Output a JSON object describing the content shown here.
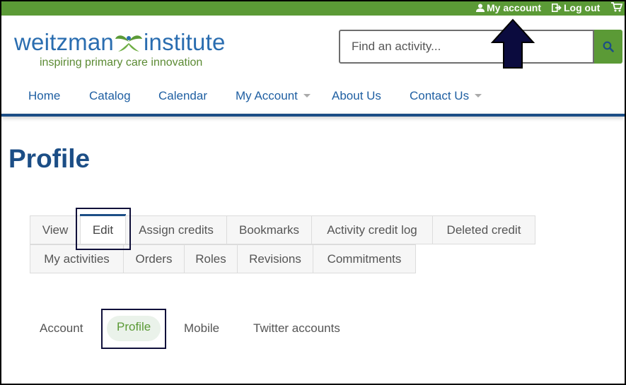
{
  "topbar": {
    "my_account": "My account",
    "log_out": "Log out"
  },
  "logo": {
    "name_left": "weitzman",
    "name_right": "institute",
    "tagline": "inspiring primary care innovation"
  },
  "search": {
    "placeholder": "Find an activity..."
  },
  "nav": {
    "items": [
      {
        "label": "Home"
      },
      {
        "label": "Catalog"
      },
      {
        "label": "Calendar"
      },
      {
        "label": "My Account"
      },
      {
        "label": "About Us"
      },
      {
        "label": "Contact Us"
      }
    ]
  },
  "page": {
    "title": "Profile"
  },
  "tabs": {
    "row1": [
      {
        "label": "View"
      },
      {
        "label": "Edit"
      },
      {
        "label": "Assign credits"
      },
      {
        "label": "Bookmarks"
      },
      {
        "label": "Activity credit log"
      },
      {
        "label": "Deleted credit"
      }
    ],
    "row2": [
      {
        "label": "My activities"
      },
      {
        "label": "Orders"
      },
      {
        "label": "Roles"
      },
      {
        "label": "Revisions"
      },
      {
        "label": "Commitments"
      }
    ],
    "active": "Edit"
  },
  "subtabs": {
    "items": [
      {
        "label": "Account"
      },
      {
        "label": "Profile"
      },
      {
        "label": "Mobile"
      },
      {
        "label": "Twitter accounts"
      }
    ],
    "active": "Profile"
  },
  "colors": {
    "brand_green": "#5b9a36",
    "brand_blue": "#1c4e86",
    "link_blue": "#1f5fa2",
    "highlight_border": "#10103a"
  },
  "icons": [
    "user-icon",
    "sign-out-icon",
    "cart-icon",
    "search-icon",
    "caret-down-icon",
    "leaf-logo-icon",
    "arrow-up-annotation"
  ]
}
